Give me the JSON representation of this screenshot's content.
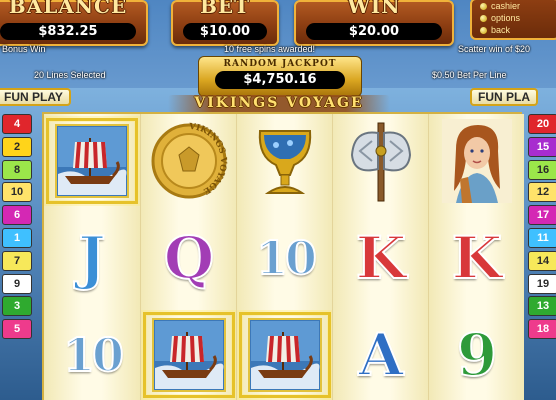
{
  "top": {
    "balance": {
      "label": "BALANCE",
      "value": "$832.25"
    },
    "bet": {
      "label": "BET",
      "value": "$10.00"
    },
    "win": {
      "label": "WIN",
      "value": "$20.00"
    }
  },
  "menu": {
    "items": [
      "cashier",
      "options",
      "back"
    ]
  },
  "messages": {
    "left": "Bonus Win",
    "center": "10 free spins awarded!",
    "right": "Scatter win of $20"
  },
  "lines_selected": "20 Lines Selected",
  "bet_per_line": "$0.50 Bet Per Line",
  "jackpot": {
    "label": "RANDOM JACKPOT",
    "value": "$4,750.16"
  },
  "logo": "VIKINGS VOYAGE",
  "fun_play_left": "FUN PLAY",
  "fun_play_right": "FUN PLA",
  "paylines_left": [
    {
      "n": "4",
      "color": "#e0262c",
      "text": "#ffffff"
    },
    {
      "n": "2",
      "color": "#ffd41a",
      "text": "#2a2a2a"
    },
    {
      "n": "8",
      "color": "#9be64a",
      "text": "#2a2a2a"
    },
    {
      "n": "10",
      "color": "#ffe36a",
      "text": "#2a2a2a"
    },
    {
      "n": "6",
      "color": "#d428b4",
      "text": "#ffffff"
    },
    {
      "n": "1",
      "color": "#3fc0ff",
      "text": "#ffffff"
    },
    {
      "n": "7",
      "color": "#f7e85a",
      "text": "#2a2a2a"
    },
    {
      "n": "9",
      "color": "#ffffff",
      "text": "#2a2a2a"
    },
    {
      "n": "3",
      "color": "#2faa2f",
      "text": "#ffffff"
    },
    {
      "n": "5",
      "color": "#ee3b8c",
      "text": "#ffffff"
    }
  ],
  "paylines_right": [
    {
      "n": "20",
      "color": "#e0262c",
      "text": "#ffffff"
    },
    {
      "n": "15",
      "color": "#a82ccf",
      "text": "#ffffff"
    },
    {
      "n": "16",
      "color": "#9be64a",
      "text": "#2a2a2a"
    },
    {
      "n": "12",
      "color": "#ffe36a",
      "text": "#2a2a2a"
    },
    {
      "n": "17",
      "color": "#d428b4",
      "text": "#ffffff"
    },
    {
      "n": "11",
      "color": "#3fc0ff",
      "text": "#ffffff"
    },
    {
      "n": "14",
      "color": "#f7e85a",
      "text": "#2a2a2a"
    },
    {
      "n": "19",
      "color": "#ffffff",
      "text": "#2a2a2a"
    },
    {
      "n": "13",
      "color": "#2faa2f",
      "text": "#ffffff"
    },
    {
      "n": "18",
      "color": "#ee3b8c",
      "text": "#ffffff"
    }
  ],
  "reels": [
    [
      {
        "symbol": "viking-ship",
        "highlight": true
      },
      {
        "symbol": "J",
        "color": "#3b8fd6"
      },
      {
        "symbol": "10",
        "color": "#6aa0d0"
      }
    ],
    [
      {
        "symbol": "gold-coin",
        "coin_text": "VIKINGS VOYAGE"
      },
      {
        "symbol": "Q",
        "color": "#a23db5"
      },
      {
        "symbol": "viking-ship",
        "highlight": true
      }
    ],
    [
      {
        "symbol": "golden-goblet"
      },
      {
        "symbol": "10",
        "color": "#6aa0d0"
      },
      {
        "symbol": "viking-ship",
        "highlight": true
      }
    ],
    [
      {
        "symbol": "battle-axe"
      },
      {
        "symbol": "K",
        "color": "#d8383a"
      },
      {
        "symbol": "A",
        "color": "#2f6fc4"
      }
    ],
    [
      {
        "symbol": "viking-woman"
      },
      {
        "symbol": "K",
        "color": "#d8383a"
      },
      {
        "symbol": "9",
        "color": "#2e9a3a"
      }
    ]
  ]
}
